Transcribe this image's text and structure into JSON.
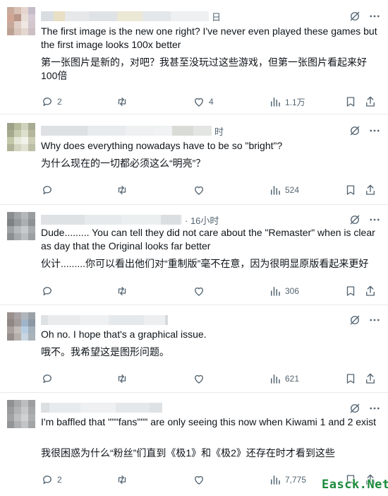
{
  "posts": [
    {
      "time": "日",
      "text_en": "The first image is the new one right? I've never even played these games but the first image looks 100x better",
      "text_zh": "第一张图片是新的，对吧？我甚至没玩过这些游戏，但第一张图片看起来好100倍",
      "replies": "2",
      "reposts": "",
      "likes": "4",
      "views": "1.1万"
    },
    {
      "time": "时",
      "text_en": "Why does everything nowadays have to be so \"bright\"?",
      "text_zh": "为什么现在的一切都必须这么“明亮”？",
      "replies": "",
      "reposts": "",
      "likes": "",
      "views": "524"
    },
    {
      "time": "· 16小时",
      "text_en": "Dude......... You can tell they did not care about the \"Remaster\" when is clear as day that the Original looks far better",
      "text_zh": "伙计.........你可以看出他们对“重制版”毫不在意，因为很明显原版看起来更好",
      "replies": "",
      "reposts": "",
      "likes": "",
      "views": "306"
    },
    {
      "time": "",
      "text_en": "Oh no. I hope that's a graphical issue.",
      "text_zh": "哦不。我希望这是图形问题。",
      "replies": "",
      "reposts": "",
      "likes": "",
      "views": "621"
    },
    {
      "time": "",
      "text_en": "I'm baffled that \"\"\"fans\"\"\" are only seeing this now when Kiwami 1 and 2 exist",
      "text_zh": "我很困惑为什么“粉丝”们直到《极1》和《极2》还存在时才看到这些",
      "replies": "2",
      "reposts": "",
      "likes": "",
      "views": "7,775"
    }
  ],
  "watermark": "Easck.Net",
  "icons": [
    "grok-icon",
    "more-icon",
    "reply-icon",
    "repost-icon",
    "like-icon",
    "views-icon",
    "bookmark-icon",
    "share-icon"
  ],
  "colors": {
    "text": "#0f1419",
    "muted": "#536471",
    "divider": "#e6e9ec",
    "watermark": "#1a8a3a"
  }
}
